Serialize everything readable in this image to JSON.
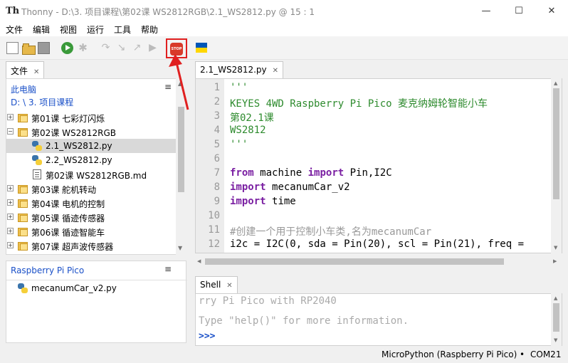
{
  "window": {
    "title": "Thonny  -  D:\\3. 项目课程\\第02课 WS2812RGB\\2.1_WS2812.py  @  15 : 1",
    "app_icon": "Th",
    "minimize": "—",
    "maximize": "☐",
    "close": "✕"
  },
  "menu": [
    "文件",
    "编辑",
    "视图",
    "运行",
    "工具",
    "帮助"
  ],
  "toolbar": {
    "icons": [
      "new-file-icon",
      "open-file-icon",
      "save-icon",
      "run-icon",
      "debug-icon",
      "step-over-icon",
      "step-into-icon",
      "step-out-icon",
      "resume-icon",
      "stop-icon",
      "ukraine-flag-icon"
    ],
    "stop_label": "STOP",
    "debug_glyph": "✱",
    "step_over_glyph": "↷",
    "step_into_glyph": "↘",
    "step_out_glyph": "↗",
    "resume_glyph": "▶"
  },
  "files_panel": {
    "tab_label": "文件",
    "tab_close": "✕",
    "menu_glyph": "≡",
    "location_line1": "此电脑",
    "location_line2": "D: \\ 3. 项目课程",
    "items": [
      {
        "label": "第01课 七彩灯闪烁",
        "type": "folder",
        "expander": "+",
        "selected": false
      },
      {
        "label": "第02课 WS2812RGB",
        "type": "folder",
        "expander": "−",
        "selected": false
      },
      {
        "label": "2.1_WS2812.py",
        "type": "python",
        "expander": "",
        "selected": true
      },
      {
        "label": "2.2_WS2812.py",
        "type": "python",
        "expander": "",
        "selected": false
      },
      {
        "label": "第02课 WS2812RGB.md",
        "type": "markdown",
        "expander": "",
        "selected": false
      },
      {
        "label": "第03课 舵机转动",
        "type": "folder",
        "expander": "+",
        "selected": false
      },
      {
        "label": "第04课 电机的控制",
        "type": "folder",
        "expander": "+",
        "selected": false
      },
      {
        "label": "第05课 循迹传感器",
        "type": "folder",
        "expander": "+",
        "selected": false
      },
      {
        "label": "第06课 循迹智能车",
        "type": "folder",
        "expander": "+",
        "selected": false
      },
      {
        "label": "第07课 超声波传感器",
        "type": "folder",
        "expander": "+",
        "selected": false
      }
    ]
  },
  "device_panel": {
    "title": "Raspberry Pi Pico",
    "menu_glyph": "≡",
    "items": [
      {
        "label": "mecanumCar_v2.py",
        "type": "python"
      }
    ]
  },
  "editor": {
    "tab_label": "2.1_WS2812.py",
    "tab_close": "✕",
    "line_numbers": [
      "1",
      "2",
      "3",
      "4",
      "5",
      "6",
      "7",
      "8",
      "9",
      "10",
      "11",
      "12"
    ],
    "lines": [
      "'''",
      "KEYES 4WD Raspberry Pi Pico 麦克纳姆轮智能小车",
      "第02.1课",
      "WS2812",
      "'''",
      "",
      "from machine import Pin,I2C",
      "import mecanumCar_v2",
      "import time",
      "",
      "#创建一个用于控制小车类,名为mecanumCar",
      "i2c = I2C(0, sda = Pin(20), scl = Pin(21), freq ="
    ]
  },
  "shell": {
    "tab_label": "Shell",
    "tab_close": "✕",
    "lines": [
      "rry Pi Pico with RP2040",
      "Type \"help()\" for more information."
    ],
    "prompt": ">>>"
  },
  "statusbar": {
    "interpreter": "MicroPython (Raspberry Pi Pico)",
    "separator": "•",
    "port": "COM21"
  },
  "colors": {
    "accent_blue": "#1a50c8",
    "string_green": "#2e8b2e",
    "keyword_purple": "#7a1fa2",
    "highlight_red": "#e02020"
  }
}
